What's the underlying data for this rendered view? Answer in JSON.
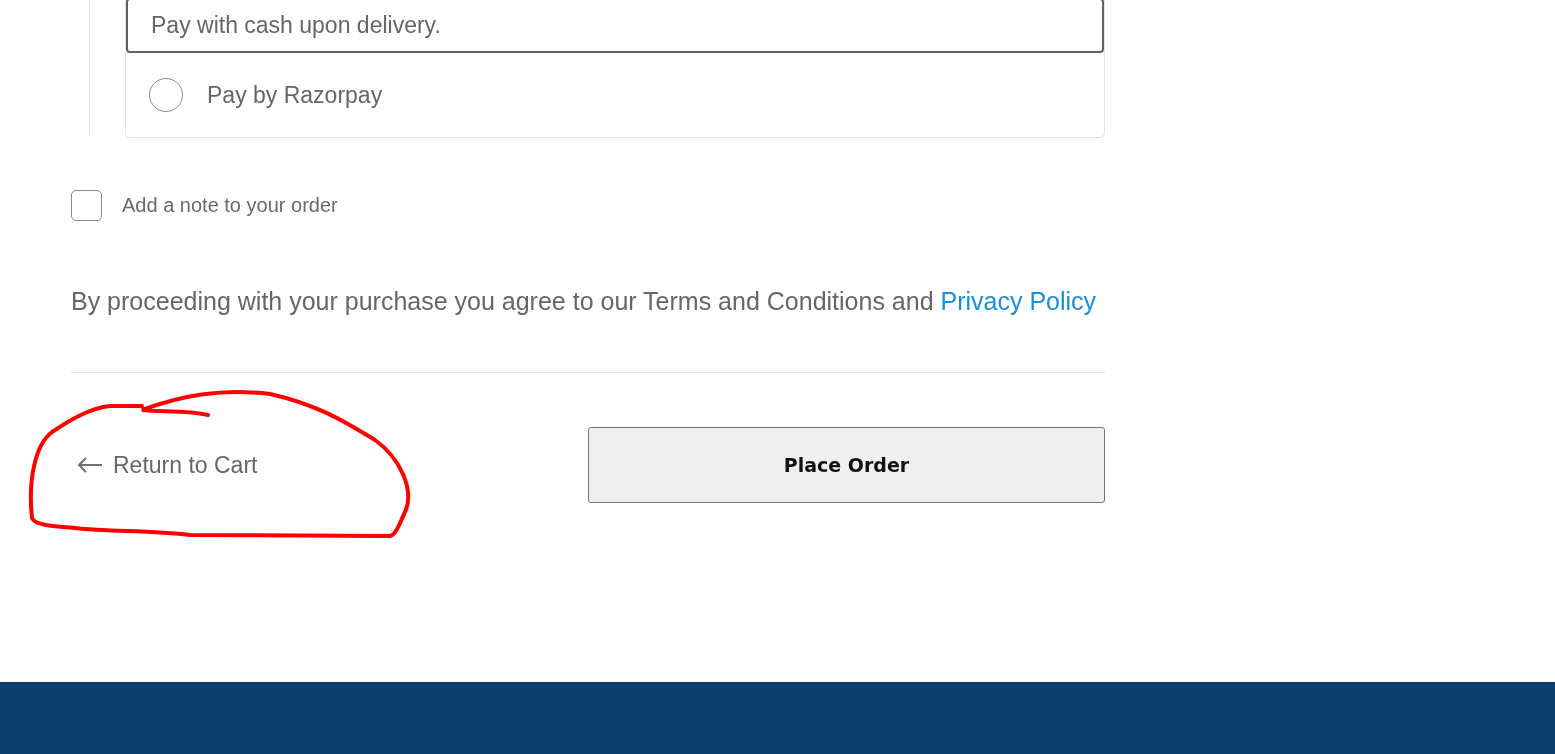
{
  "payment_options": [
    {
      "description": "Pay with cash upon delivery.",
      "selected": true
    },
    {
      "label": "Pay by Razorpay",
      "selected": false
    }
  ],
  "order_note": {
    "label": "Add a note to your order",
    "checked": false
  },
  "terms": {
    "text": "By proceeding with your purchase you agree to our Terms and Conditions and ",
    "link": "Privacy Policy"
  },
  "return_link": {
    "label": "Return to Cart"
  },
  "place_order_button": {
    "label": "Place Order"
  }
}
